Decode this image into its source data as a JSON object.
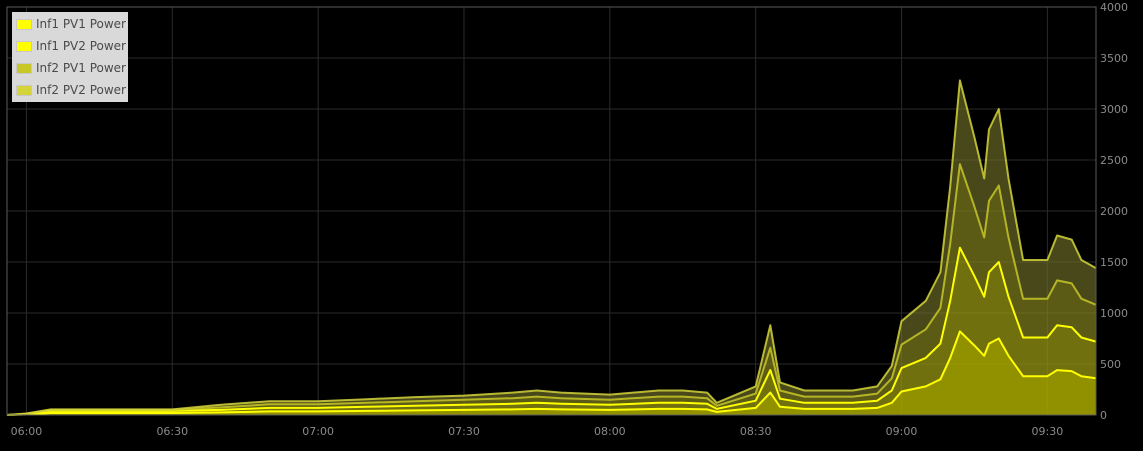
{
  "chart_data": {
    "type": "area",
    "stacked": true,
    "x_axis": {
      "ticks": [
        "06:00",
        "06:30",
        "07:00",
        "07:30",
        "08:00",
        "08:30",
        "09:00",
        "09:30"
      ],
      "start": "05:56",
      "end": "09:40"
    },
    "y_axis": {
      "ylim": [
        0,
        4000
      ],
      "ticks": [
        0,
        500,
        1000,
        1500,
        2000,
        2500,
        3000,
        3500,
        4000
      ],
      "position": "right"
    },
    "grid": true,
    "legend_position": "top-left",
    "colors": {
      "background": "#000000",
      "grid": "#2a2a2a",
      "border": "#5a5a5a",
      "legend_bg": "#d9d9d9"
    },
    "series": [
      {
        "name": "Inf1 PV1 Power",
        "color": "#ffff00",
        "x": [
          "05:56",
          "06:00",
          "06:05",
          "06:10",
          "06:20",
          "06:30",
          "06:40",
          "06:50",
          "07:00",
          "07:10",
          "07:20",
          "07:30",
          "07:40",
          "07:45",
          "07:50",
          "08:00",
          "08:10",
          "08:15",
          "08:20",
          "08:22",
          "08:30",
          "08:33",
          "08:35",
          "08:40",
          "08:50",
          "08:55",
          "08:58",
          "09:00",
          "09:05",
          "09:08",
          "09:10",
          "09:12",
          "09:15",
          "09:17",
          "09:18",
          "09:20",
          "09:22",
          "09:25",
          "09:30",
          "09:32",
          "09:35",
          "09:37",
          "09:40"
        ],
        "values": [
          0,
          5,
          20,
          20,
          20,
          20,
          25,
          35,
          35,
          40,
          45,
          50,
          55,
          60,
          55,
          50,
          60,
          60,
          55,
          30,
          70,
          220,
          80,
          60,
          60,
          70,
          120,
          230,
          280,
          350,
          560,
          820,
          680,
          580,
          700,
          750,
          580,
          380,
          380,
          440,
          430,
          380,
          360
        ]
      },
      {
        "name": "Inf1 PV2 Power",
        "color": "#ffff00",
        "x": [
          "05:56",
          "06:00",
          "06:05",
          "06:10",
          "06:20",
          "06:30",
          "06:40",
          "06:50",
          "07:00",
          "07:10",
          "07:20",
          "07:30",
          "07:40",
          "07:45",
          "07:50",
          "08:00",
          "08:10",
          "08:15",
          "08:20",
          "08:22",
          "08:30",
          "08:33",
          "08:35",
          "08:40",
          "08:50",
          "08:55",
          "08:58",
          "09:00",
          "09:05",
          "09:08",
          "09:10",
          "09:12",
          "09:15",
          "09:17",
          "09:18",
          "09:20",
          "09:22",
          "09:25",
          "09:30",
          "09:32",
          "09:35",
          "09:37",
          "09:40"
        ],
        "values": [
          0,
          5,
          20,
          20,
          20,
          20,
          25,
          35,
          35,
          40,
          45,
          50,
          55,
          60,
          55,
          50,
          60,
          60,
          55,
          30,
          70,
          220,
          80,
          60,
          60,
          70,
          120,
          230,
          280,
          350,
          560,
          820,
          680,
          580,
          700,
          750,
          580,
          380,
          380,
          440,
          430,
          380,
          360
        ]
      },
      {
        "name": "Inf2 PV1 Power",
        "color": "#c8c828",
        "x": [
          "05:56",
          "06:00",
          "06:05",
          "06:10",
          "06:20",
          "06:30",
          "06:40",
          "06:50",
          "07:00",
          "07:10",
          "07:20",
          "07:30",
          "07:40",
          "07:45",
          "07:50",
          "08:00",
          "08:10",
          "08:15",
          "08:20",
          "08:22",
          "08:30",
          "08:33",
          "08:35",
          "08:40",
          "08:50",
          "08:55",
          "08:58",
          "09:00",
          "09:05",
          "09:08",
          "09:10",
          "09:12",
          "09:15",
          "09:17",
          "09:18",
          "09:20",
          "09:22",
          "09:25",
          "09:30",
          "09:32",
          "09:35",
          "09:37",
          "09:40"
        ],
        "values": [
          0,
          3,
          10,
          10,
          10,
          10,
          25,
          35,
          35,
          40,
          45,
          50,
          55,
          60,
          55,
          50,
          60,
          60,
          55,
          30,
          70,
          220,
          80,
          60,
          60,
          70,
          120,
          230,
          280,
          350,
          560,
          820,
          680,
          580,
          700,
          750,
          580,
          380,
          380,
          440,
          430,
          380,
          360
        ]
      },
      {
        "name": "Inf2 PV2 Power",
        "color": "#d4d43a",
        "x": [
          "05:56",
          "06:00",
          "06:05",
          "06:10",
          "06:20",
          "06:30",
          "06:40",
          "06:50",
          "07:00",
          "07:10",
          "07:20",
          "07:30",
          "07:40",
          "07:45",
          "07:50",
          "08:00",
          "08:10",
          "08:15",
          "08:20",
          "08:22",
          "08:30",
          "08:33",
          "08:35",
          "08:40",
          "08:50",
          "08:55",
          "08:58",
          "09:00",
          "09:05",
          "09:08",
          "09:10",
          "09:12",
          "09:15",
          "09:17",
          "09:18",
          "09:20",
          "09:22",
          "09:25",
          "09:30",
          "09:32",
          "09:35",
          "09:37",
          "09:40"
        ],
        "values": [
          0,
          2,
          5,
          5,
          5,
          5,
          25,
          30,
          30,
          35,
          40,
          40,
          55,
          60,
          55,
          50,
          60,
          60,
          55,
          30,
          70,
          220,
          80,
          60,
          60,
          70,
          120,
          230,
          280,
          350,
          560,
          820,
          680,
          580,
          700,
          750,
          580,
          380,
          380,
          440,
          430,
          380,
          360
        ]
      }
    ]
  }
}
